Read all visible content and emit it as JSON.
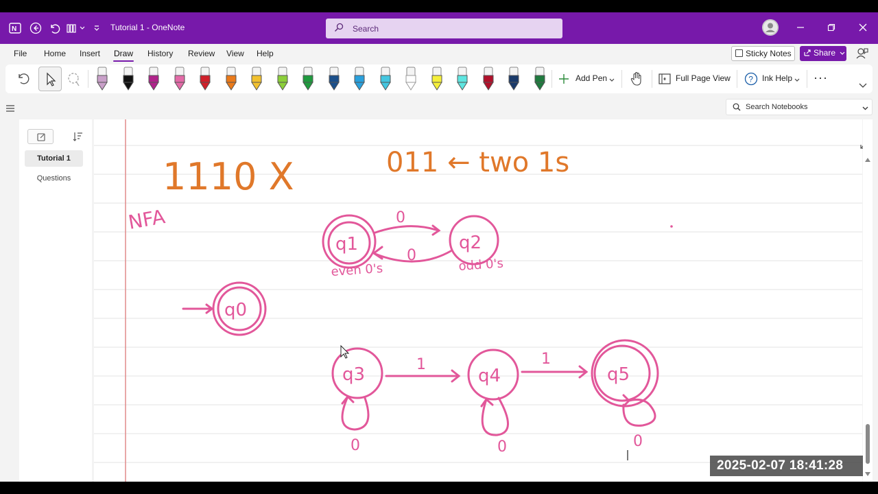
{
  "titlebar": {
    "document_title": "Tutorial 1 - OneNote",
    "search_placeholder": "Search"
  },
  "menu": {
    "items": [
      "File",
      "Home",
      "Insert",
      "Draw",
      "History",
      "Review",
      "View",
      "Help"
    ],
    "active": "Draw",
    "sticky_notes": "Sticky Notes",
    "share": "Share"
  },
  "toolbar": {
    "add_pen": "Add Pen",
    "full_page_view": "Full Page View",
    "ink_help": "Ink Help",
    "more": "···",
    "pen_colors": [
      "#c9a0c9",
      "#111111",
      "#b0238a",
      "#e36ba8",
      "#d0202a",
      "#ea7a1a",
      "#f2c12e",
      "#8ccf3a",
      "#1f9a3e",
      "#1b4f8a",
      "#2aa0dc",
      "#44c6e0",
      "#ffffff",
      "#f5ef3a",
      "#5ee5e0",
      "#b0102a",
      "#1a3a6a",
      "#1f7a3e"
    ]
  },
  "navigation": {
    "search_notebooks": "Search Notebooks",
    "pages": [
      "Tutorial 1",
      "Questions"
    ],
    "active_page": "Tutorial 1"
  },
  "ink": {
    "orange_heading_1": "1110 X",
    "orange_heading_2": "011 ← two 1s",
    "label_nfa": "NFA",
    "state_q0": "q0",
    "state_q1": "q1",
    "state_q2": "q2",
    "state_q3": "q3",
    "state_q4": "q4",
    "state_q5": "q5",
    "edge_q1_q2": "0",
    "edge_q2_q1": "0",
    "label_even": "even 0's",
    "label_odd": "odd 0's",
    "edge_q3_q4": "1",
    "edge_q4_q5": "1",
    "loop_q3": "0",
    "loop_q4": "0",
    "loop_q5": "0",
    "ink_colors": {
      "orange": "#e0782a",
      "pink": "#e2579a"
    }
  },
  "timestamp": "2025-02-07  18:41:28"
}
